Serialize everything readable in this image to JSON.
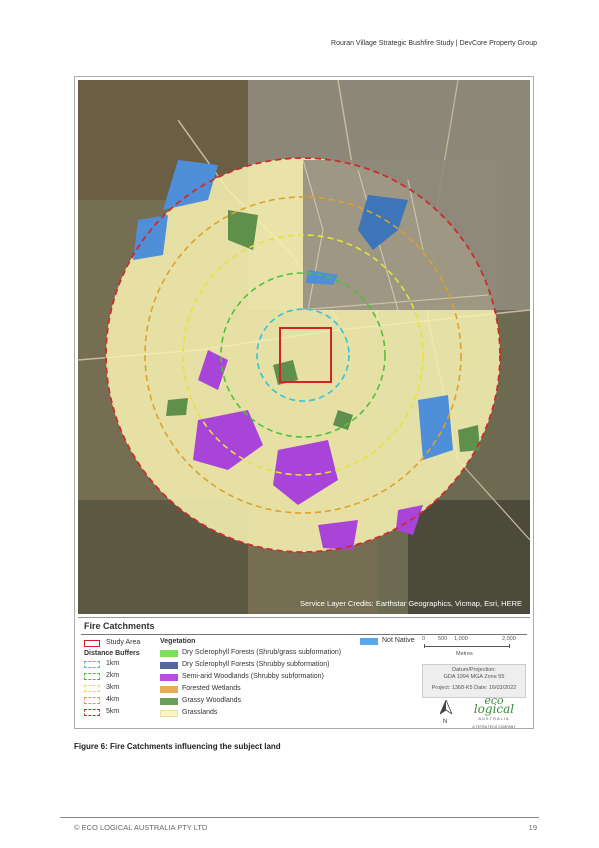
{
  "header": {
    "text": "Rouran Village Strategic Bushfire Study | DevCore Property Group"
  },
  "map": {
    "credits": "Service Layer Credits: Earthstar Geographics, Vicmap, Esri, HERE"
  },
  "legend": {
    "title": "Fire Catchments",
    "study_area": "Study Area",
    "distance_heading": "Distance Buffers",
    "buffers": [
      {
        "label": "1km",
        "color": "#35c3d9"
      },
      {
        "label": "2km",
        "color": "#4fc03a"
      },
      {
        "label": "3km",
        "color": "#e7e338"
      },
      {
        "label": "4km",
        "color": "#e0a12c"
      },
      {
        "label": "5km",
        "color": "#cc2c2c"
      }
    ],
    "vegetation_heading": "Vegetation",
    "vegetation": [
      {
        "label": "Dry Sclerophyll Forests (Shrub/grass subformation)",
        "color": "#7de05a"
      },
      {
        "label": "Dry Sclerophyll Forests (Shrubby subformation)",
        "color": "#56679b"
      },
      {
        "label": "Semi-arid Woodlands (Shrubby subformation)",
        "color": "#b84de6"
      },
      {
        "label": "Forested Wetlands",
        "color": "#e7aa56"
      },
      {
        "label": "Grassy Woodlands",
        "color": "#6aa05c"
      },
      {
        "label": "Grasslands",
        "color": "#fbf6c4"
      }
    ],
    "not_native": {
      "label": "Not Native",
      "color": "#59a8ef"
    },
    "scale_labels": [
      "0",
      "500",
      "1,000",
      "2,000"
    ],
    "scale_unit": "Metres",
    "datum": "Datum/Projection:",
    "projection": "GDA 1994 MGA Zone 55",
    "project_date": "Project: 1368-K5   Date: 16/03/2022",
    "north_label": "N",
    "logo_line1": "eco",
    "logo_line2": "logical",
    "logo_line3": "AUSTRALIA",
    "logo_tag": "A TETRA TECH COMPANY"
  },
  "caption": "Figure 6: Fire Catchments influencing the subject land",
  "footer": {
    "left": "© ECO LOGICAL AUSTRALIA PTY LTD",
    "page": "19"
  }
}
